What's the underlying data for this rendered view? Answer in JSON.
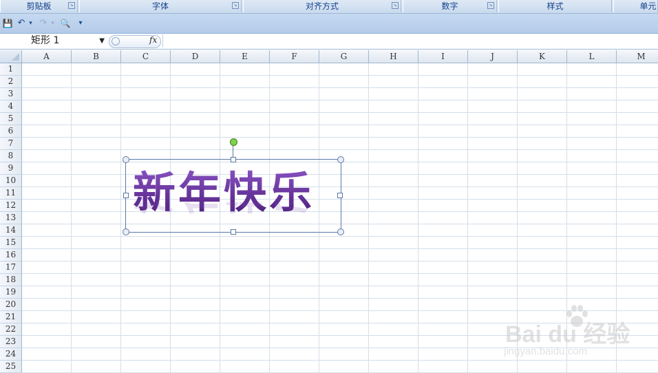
{
  "ribbon": {
    "groups": [
      {
        "label": "剪贴板",
        "launcher": true
      },
      {
        "label": "字体",
        "launcher": true
      },
      {
        "label": "对齐方式",
        "launcher": true
      },
      {
        "label": "数字",
        "launcher": true
      },
      {
        "label": "样式",
        "launcher": false
      },
      {
        "label": "单元",
        "launcher": false
      }
    ],
    "launcher_glyph": "↘"
  },
  "quick_access": {
    "icons": [
      "save-icon",
      "undo-icon",
      "redo-icon",
      "print-preview-icon",
      "customize-toolbar-icon"
    ],
    "save_glyph": "💾",
    "undo_glyph": "↶",
    "redo_glyph": "↷",
    "preview_glyph": "🔍",
    "customize_glyph": "▾",
    "dropdown_glyph": "▾"
  },
  "formula_bar": {
    "name_box_value": "矩形 1",
    "name_box_arrow": "▼",
    "fx_label": "fx",
    "formula_value": ""
  },
  "sheet": {
    "columns": [
      "A",
      "B",
      "C",
      "D",
      "E",
      "F",
      "G",
      "H",
      "I",
      "J",
      "K",
      "L",
      "M"
    ],
    "rows": [
      "1",
      "2",
      "3",
      "4",
      "5",
      "6",
      "7",
      "8",
      "9",
      "10",
      "11",
      "12",
      "13",
      "14",
      "15",
      "16",
      "17",
      "18",
      "19",
      "20",
      "21",
      "22",
      "23",
      "24",
      "25"
    ]
  },
  "shape": {
    "name": "矩形 1",
    "wordart_text": "新年快乐",
    "text_color_top": "#8a53c4",
    "text_color_bottom": "#4a1c78",
    "rotation_handle_color": "#7ed34a"
  },
  "watermark": {
    "brand": "Bai du 经验",
    "url": "jingyan.baidu.com"
  },
  "colors": {
    "ribbon_text": "#15428b",
    "grid_line": "#d4deea",
    "header_border": "#9eb6ce",
    "selection_border": "#5a78a6"
  }
}
